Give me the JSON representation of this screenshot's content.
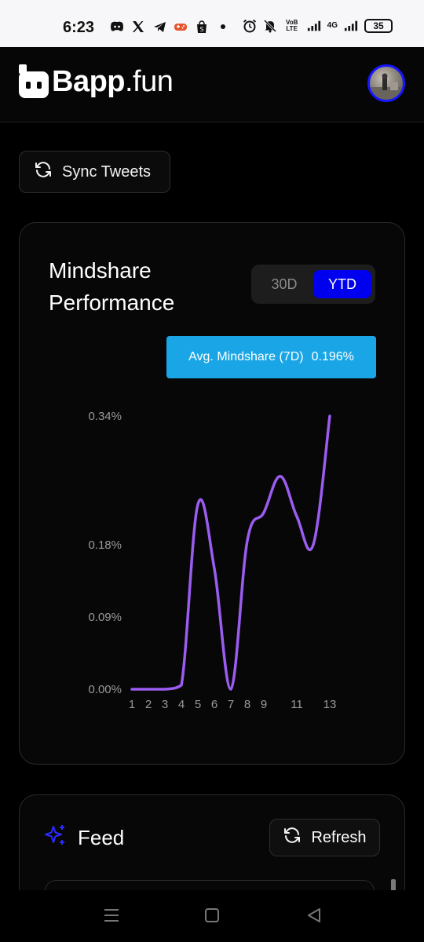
{
  "status_bar": {
    "time": "6:23",
    "network": "4G",
    "volte": "VoB LTE",
    "battery": "35",
    "app_icons": [
      "discord-icon",
      "x-icon",
      "telegram-icon",
      "game-icon",
      "shop-icon",
      "dot-icon"
    ],
    "system_icons": [
      "alarm-icon",
      "mute-icon",
      "volte-icon",
      "signal-icon",
      "signal-icon"
    ]
  },
  "header": {
    "logo_bold": "Bapp",
    "logo_suffix": ".fun"
  },
  "sync_button": {
    "label": "Sync Tweets"
  },
  "mindshare": {
    "title": "Mindshare Performance",
    "toggle": [
      {
        "label": "30D",
        "active": false
      },
      {
        "label": "YTD",
        "active": true
      }
    ],
    "tooltip_label": "Avg. Mindshare (7D)",
    "tooltip_value": "0.196%"
  },
  "chart_data": {
    "type": "line",
    "x": [
      1,
      2,
      3,
      4,
      5,
      6,
      7,
      8,
      9,
      10,
      11,
      12,
      13
    ],
    "x_tick_labels": [
      "1",
      "2",
      "3",
      "4",
      "5",
      "6",
      "7",
      "8",
      "9",
      "11",
      "13"
    ],
    "y_tick_labels": [
      "0.00%",
      "0.09%",
      "0.18%",
      "0.34%"
    ],
    "y_ticks": [
      0.0,
      0.09,
      0.18,
      0.34
    ],
    "ylim": [
      0,
      0.34
    ],
    "series": [
      {
        "values": [
          0.0,
          0.0,
          0.0,
          0.005,
          0.23,
          0.15,
          0.0,
          0.185,
          0.22,
          0.265,
          0.215,
          0.18,
          0.34
        ]
      }
    ],
    "colors": {
      "line": "#9b5cf0"
    },
    "grid": false
  },
  "feed": {
    "title": "Feed",
    "refresh_label": "Refresh"
  },
  "colors": {
    "accent_blue": "#0000ee",
    "tooltip_blue": "#1aa6e6",
    "line_purple": "#9b5cf0"
  }
}
